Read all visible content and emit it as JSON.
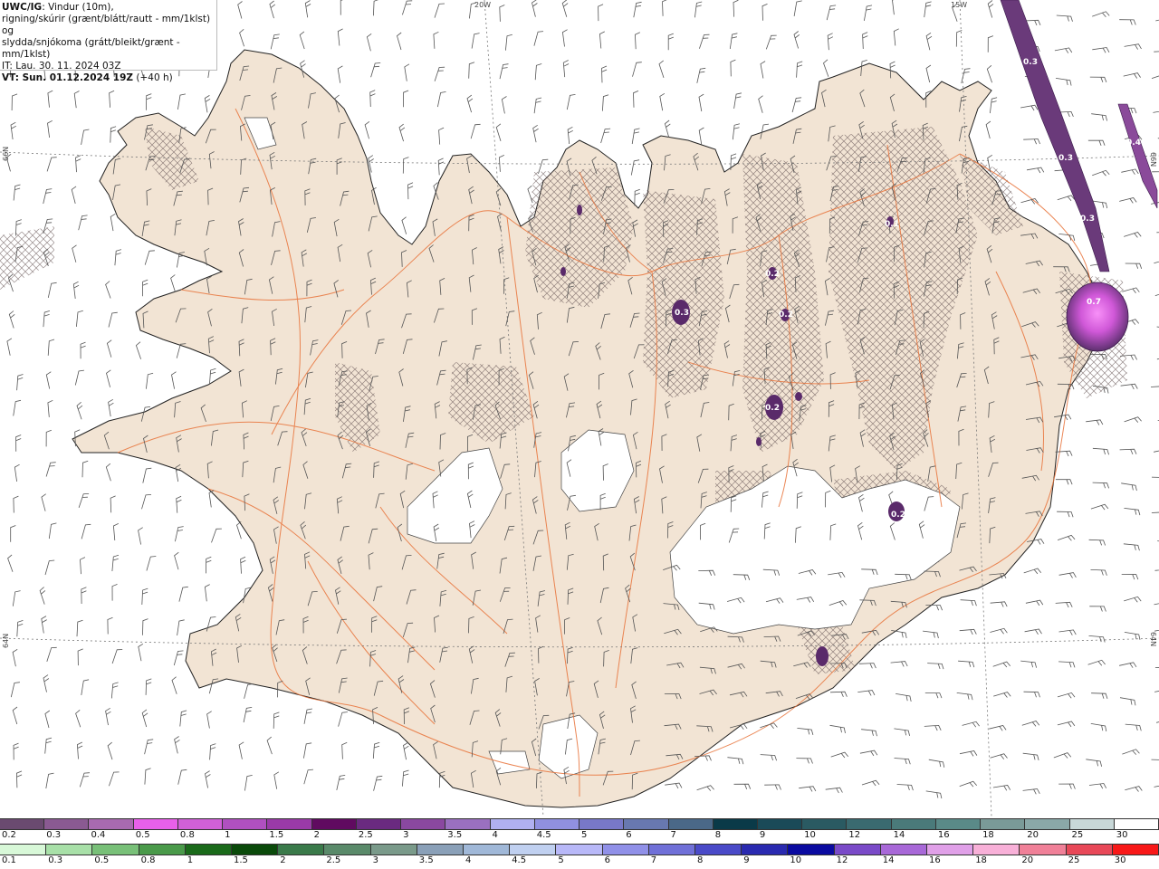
{
  "legend": {
    "code": "UWC/IG",
    "line1": ": Vindur (10m),",
    "line2": "rigning/skúrir (grænt/blátt/rautt - mm/1klst) og",
    "line3": "slydda/snjókoma (grátt/bleikt/grænt - mm/1klst)",
    "it_line": "IT: Lau. 30. 11. 2024 03Z",
    "vt_line_bold": "VT: Sun. 01.12.2024 19Z",
    "vt_line_rest": " (+40 h)"
  },
  "grid_labels": {
    "lon_20w": "20W",
    "lon_15w": "15W",
    "lat_66n_left": "66N",
    "lat_66n_right": "66N",
    "lat_64n_left": "64N",
    "lat_64n_right": "64N"
  },
  "precip_labels": [
    "0.3",
    "0.4",
    "0.3",
    "0.3",
    "0.7",
    "0.3",
    "0.2",
    "0.2",
    "0.2",
    "0.1",
    "0.2"
  ],
  "colors": {
    "land": "#f2e4d4",
    "glacier": "#ffffff",
    "roads": "#e8733a",
    "coast": "#222222",
    "snow_light": "#5a3a6e",
    "snow_bright": "#e860e8"
  },
  "snow_scale": {
    "values": [
      "0.2",
      "0.3",
      "0.4",
      "0.5",
      "0.8",
      "1",
      "1.5",
      "2",
      "2.5",
      "3",
      "3.5",
      "4",
      "4.5",
      "5",
      "6",
      "7",
      "8",
      "9",
      "10",
      "12",
      "14",
      "16",
      "18",
      "20",
      "25",
      "30"
    ],
    "colors": [
      "#6a4a70",
      "#8a5a92",
      "#a86ab0",
      "#e860ea",
      "#d060d8",
      "#b050c0",
      "#9a3aa8",
      "#600a60",
      "#6a2a80",
      "#8a48a0",
      "#9a70c0",
      "#b0b0f0",
      "#9090e0",
      "#7878c8",
      "#6878b0",
      "#4a6888",
      "#0a3a48",
      "#1a4a58",
      "#2a5a62",
      "#3a6a70",
      "#4a7a7a",
      "#5a8a88",
      "#7a9a98",
      "#8aa8a8",
      "#c8d8d8",
      "#ffffff"
    ]
  },
  "rain_scale": {
    "values": [
      "0.1",
      "0.3",
      "0.5",
      "0.8",
      "1",
      "1.5",
      "2",
      "2.5",
      "3",
      "3.5",
      "4",
      "4.5",
      "5",
      "6",
      "7",
      "8",
      "9",
      "10",
      "12",
      "14",
      "16",
      "18",
      "20",
      "25",
      "30"
    ],
    "colors": [
      "#d8f8d8",
      "#a8e0a8",
      "#78c078",
      "#4a9a4a",
      "#1a6a1a",
      "#0a4a0a",
      "#3a7a4a",
      "#5a8a6a",
      "#7a9a8a",
      "#8aa0b8",
      "#a0b8d8",
      "#c0d0f0",
      "#b8b8f8",
      "#9090e8",
      "#7070d8",
      "#4a4ac8",
      "#2a2ab0",
      "#0a0aa0",
      "#7a4ac8",
      "#a868d8",
      "#e0a0e8",
      "#f8b0d8",
      "#f08098",
      "#e84858",
      "#f81818"
    ]
  }
}
